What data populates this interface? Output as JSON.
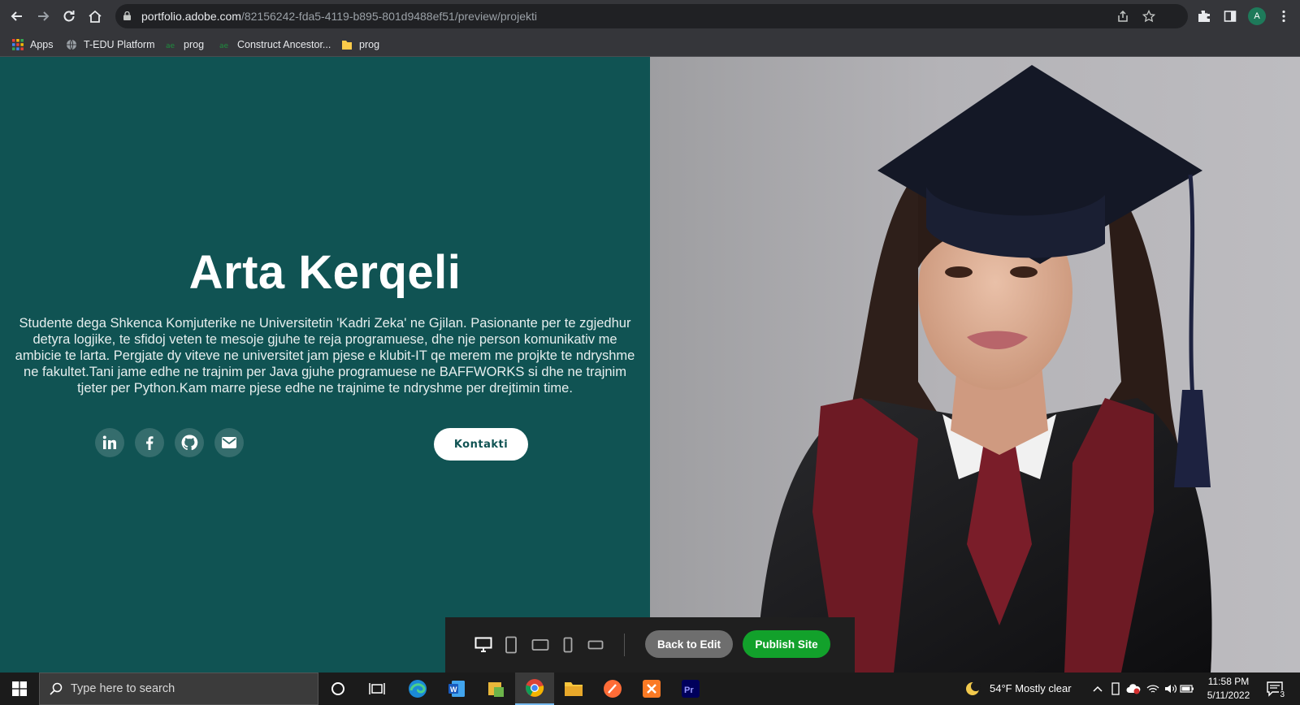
{
  "browser": {
    "url_host": "portfolio.adobe.com",
    "url_path": "/82156242-fda5-4119-b895-801d9488ef51/preview/projekti",
    "profile_initial": "A",
    "bookmarks": [
      "Apps",
      "T-EDU Platform",
      "prog",
      "Construct Ancestor...",
      "prog"
    ]
  },
  "hero": {
    "name": "Arta Kerqeli",
    "bio": "Studente dega Shkenca Komjuterike ne Universitetin 'Kadri Zeka' ne Gjilan. Pasionante per te zgjedhur detyra logjike, te sfidoj veten te mesoje gjuhe te reja programuese, dhe nje person komunikativ me ambicie te larta. Pergjate dy viteve ne universitet jam pjese e klubit-IT qe merem me projkte te ndryshme ne fakultet.Tani jame edhe ne trajnim per Java gjuhe programuese ne BAFFWORKS si dhe ne trajnim tjeter per Python.Kam marre pjese edhe ne trajnime te ndryshme per drejtimin time.",
    "contact_label": "Kontakti",
    "social_icons": [
      "linkedin-icon",
      "facebook-icon",
      "github-icon",
      "mail-icon"
    ]
  },
  "preview_bar": {
    "devices": [
      "desktop-icon",
      "tablet-portrait-icon",
      "tablet-landscape-icon",
      "phone-portrait-icon",
      "phone-landscape-icon"
    ],
    "back_label": "Back to Edit",
    "publish_label": "Publish Site"
  },
  "taskbar": {
    "search_placeholder": "Type here to search",
    "weather": "54°F  Mostly clear",
    "time": "11:58 PM",
    "date": "5/11/2022",
    "notification_count": "3"
  },
  "colors": {
    "hero_bg": "#105353",
    "publish_green": "#12a12b",
    "chrome_bg": "#35363a"
  }
}
